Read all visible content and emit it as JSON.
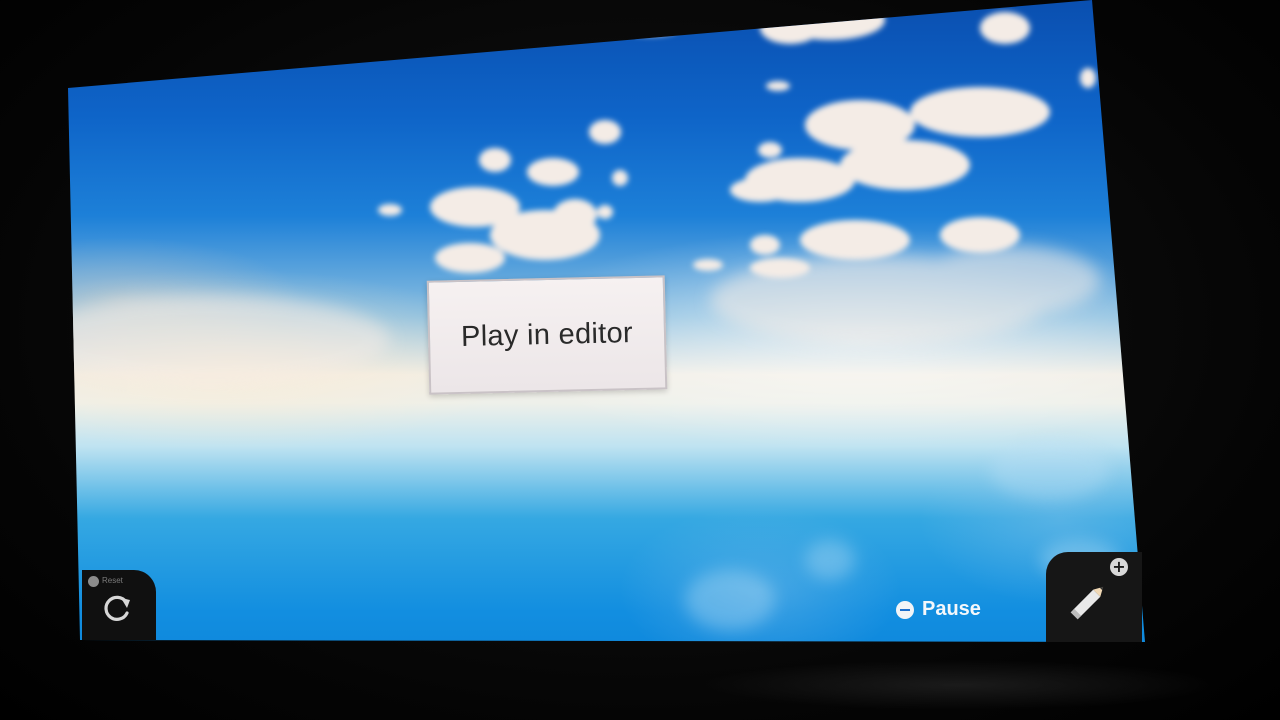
{
  "screen": {
    "background": "sky-with-clouds"
  },
  "dialog": {
    "label": "Play in editor"
  },
  "controls": {
    "pause": {
      "icon": "minus-button-icon",
      "label": "Pause"
    },
    "edit": {
      "icon": "pencil-icon",
      "badge_icon": "plus-button-icon",
      "badge_label": "+"
    },
    "reset": {
      "icon": "restart-icon",
      "caption": "Reset"
    }
  },
  "colors": {
    "sky_top": "#0a4fb0",
    "sky_bottom": "#0a7fd6",
    "horizon": "#f1eee6",
    "panel": "#f6f1f1",
    "tab": "#161616"
  }
}
